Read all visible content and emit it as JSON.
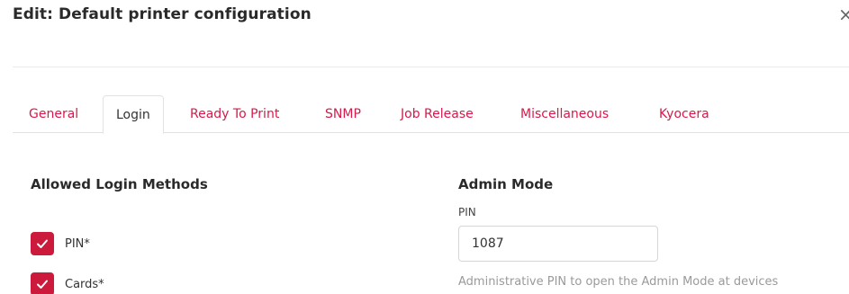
{
  "dialog": {
    "title": "Edit: Default printer configuration",
    "close_glyph": "×",
    "close_icon": "close-icon"
  },
  "tabs": [
    {
      "label": "General",
      "active": false
    },
    {
      "label": "Login",
      "active": true
    },
    {
      "label": "Ready To Print",
      "active": false
    },
    {
      "label": "SNMP",
      "active": false
    },
    {
      "label": "Job Release",
      "active": false
    },
    {
      "label": "Miscellaneous",
      "active": false
    },
    {
      "label": "Kyocera",
      "active": false
    }
  ],
  "login_methods": {
    "title": "Allowed Login Methods",
    "options": [
      {
        "label": "PIN*",
        "checked": true
      },
      {
        "label": "Cards*",
        "checked": true
      }
    ]
  },
  "admin_mode": {
    "title": "Admin Mode",
    "pin_label": "PIN",
    "pin_value": "1087",
    "help_text": "Administrative PIN to open the Admin Mode at devices"
  },
  "colors": {
    "accent": "#d6194b",
    "checkbox": "#cc1a3c",
    "text": "#2a2a2a",
    "muted": "#9a9a9a"
  }
}
